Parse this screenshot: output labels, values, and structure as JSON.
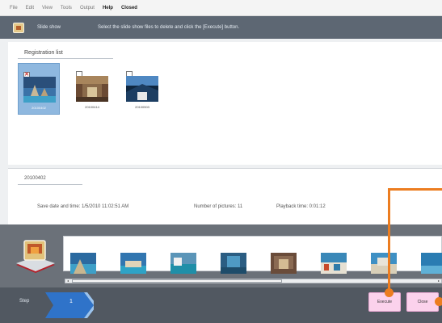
{
  "menu": [
    "File",
    "Edit",
    "View",
    "Tools",
    "Output",
    "Help",
    "Closed"
  ],
  "menu_active_index": 5,
  "title": {
    "name": "Slide show",
    "instruction": "Select the slide show files to delete and click the [Execute] button."
  },
  "registration": {
    "label": "Registration list",
    "items": [
      {
        "caption": "20100402",
        "checked": true,
        "selected": true,
        "check_mark": "✕"
      },
      {
        "caption": "20100414",
        "checked": false,
        "selected": false,
        "check_mark": ""
      },
      {
        "caption": "20100503",
        "checked": false,
        "selected": false,
        "check_mark": ""
      }
    ]
  },
  "detail": {
    "date": "20100402",
    "save_date": "Save date and time: 1/5/2010 11:02:51 AM",
    "num_pictures": "Number of pictures: 11",
    "playback": "Playback time: 0:01:12"
  },
  "scroll_arrows": {
    "left": "◂",
    "right": "▸"
  },
  "step": {
    "label": "Step",
    "number": "1"
  },
  "buttons": {
    "execute": "Execute",
    "close": "Close"
  },
  "colors": {
    "accent": "#ec7d20",
    "button": "#fbd2ec",
    "title_bar": "#5d6773",
    "bottom_bar": "#515861",
    "step_chevron": "#2f73c9",
    "selected_item": "#8fb8df"
  }
}
